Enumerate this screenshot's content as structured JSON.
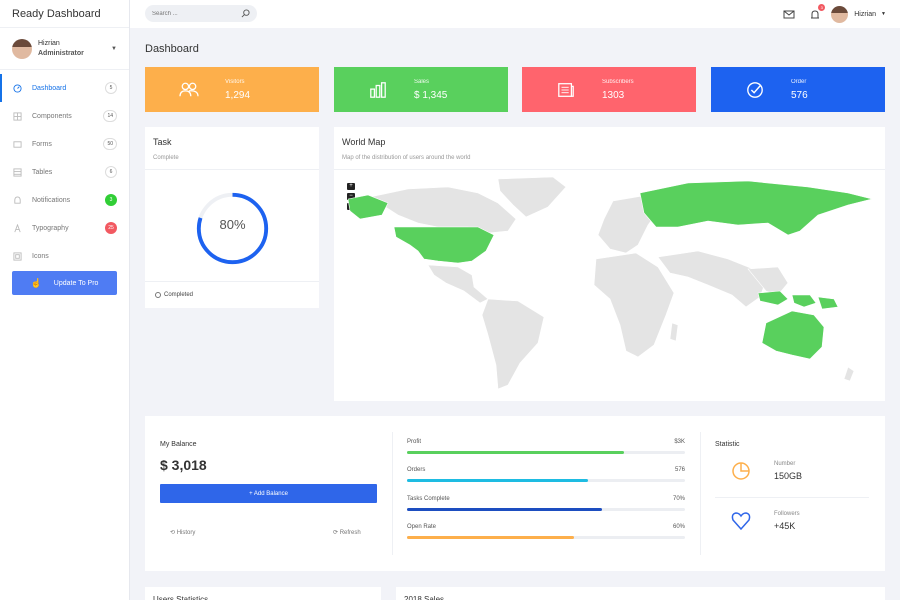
{
  "brand": "Ready Dashboard",
  "user": {
    "name": "Hizrian",
    "role": "Administrator"
  },
  "nav": [
    {
      "label": "Dashboard",
      "badge": "5",
      "badge_style": "plain",
      "icon": "dashboard-icon",
      "active": true
    },
    {
      "label": "Components",
      "badge": "14",
      "badge_style": "plain",
      "icon": "components-icon"
    },
    {
      "label": "Forms",
      "badge": "50",
      "badge_style": "plain",
      "icon": "forms-icon"
    },
    {
      "label": "Tables",
      "badge": "6",
      "badge_style": "plain",
      "icon": "tables-icon"
    },
    {
      "label": "Notifications",
      "badge": "3",
      "badge_style": "green",
      "icon": "bell-icon"
    },
    {
      "label": "Typography",
      "badge": "25",
      "badge_style": "red",
      "icon": "typography-icon"
    },
    {
      "label": "Icons",
      "badge": "",
      "badge_style": "none",
      "icon": "icons-icon"
    }
  ],
  "pro_button": "Update To Pro",
  "header": {
    "search_placeholder": "Search ...",
    "notification_count": "3",
    "user_name": "Hizrian"
  },
  "page_title": "Dashboard",
  "stats": [
    {
      "label": "Visitors",
      "value": "1,294",
      "color": "#fdaf4b",
      "icon": "users-icon"
    },
    {
      "label": "Sales",
      "value": "$ 1,345",
      "color": "#59d05d",
      "icon": "bar-chart-icon"
    },
    {
      "label": "Subscribers",
      "value": "1303",
      "color": "#ff646d",
      "icon": "newspaper-icon"
    },
    {
      "label": "Order",
      "value": "576",
      "color": "#1d62f0",
      "icon": "check-circle-icon"
    }
  ],
  "task": {
    "title": "Task",
    "subtitle": "Complete",
    "percent": "80%",
    "progress": 0.8,
    "footer": "Completed"
  },
  "map": {
    "title": "World Map",
    "subtitle": "Map of the distribution of users around the world",
    "zoom_in": "+",
    "zoom_out": "−",
    "highlight_color": "#59d05d",
    "base_color": "#e4e4e4"
  },
  "balance": {
    "title": "My Balance",
    "amount": "$ 3,018",
    "add_label": "+ Add Balance",
    "history_label": "History",
    "refresh_label": "Refresh"
  },
  "progress": [
    {
      "label": "Profit",
      "value": "$3K",
      "fill": 0.78,
      "color": "#59d05d"
    },
    {
      "label": "Orders",
      "value": "576",
      "fill": 0.65,
      "color": "#1ebce2"
    },
    {
      "label": "Tasks Complete",
      "value": "70%",
      "fill": 0.7,
      "color": "#1d4ec0"
    },
    {
      "label": "Open Rate",
      "value": "60%",
      "fill": 0.6,
      "color": "#fdaf4b"
    }
  ],
  "statistic": {
    "title": "Statistic",
    "items": [
      {
        "label": "Number",
        "value": "150GB",
        "icon": "pie-chart-icon",
        "color": "#fdaf4b"
      },
      {
        "label": "Followers",
        "value": "+45K",
        "icon": "heart-icon",
        "color": "#2f66e9"
      }
    ]
  },
  "bottom": {
    "left_title": "Users Statistics",
    "right_title": "2018 Sales"
  }
}
